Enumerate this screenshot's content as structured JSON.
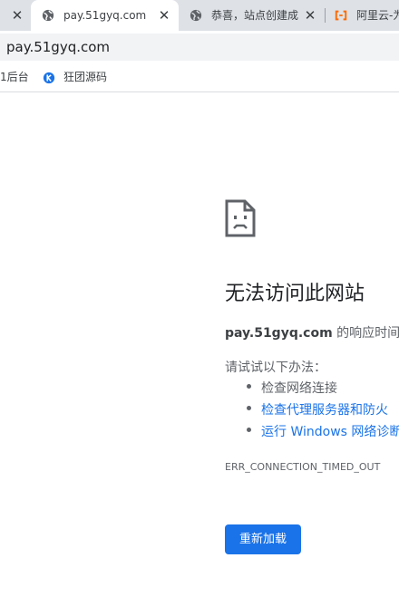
{
  "tabs": [
    {
      "title": "",
      "icon": "close-icon"
    },
    {
      "title": "pay.51gyq.com",
      "icon": "globe-icon",
      "active": true
    },
    {
      "title": "恭喜，站点创建成",
      "icon": "globe-icon"
    },
    {
      "title": "阿里云-为",
      "icon": "aliyun-icon"
    }
  ],
  "address": {
    "url": "pay.51gyq.com"
  },
  "bookmarks": [
    {
      "label": "1后台"
    },
    {
      "label": "狂团源码",
      "icon": "k-logo-icon"
    }
  ],
  "error": {
    "title": "无法访问此网站",
    "host": "pay.51gyq.com",
    "message_rest": " 的响应时间过",
    "try_title": "请试试以下办法：",
    "suggestions": [
      "检查网络连接",
      "检查代理服务器和防火",
      "运行 Windows 网络诊断"
    ],
    "code": "ERR_CONNECTION_TIMED_OUT",
    "reload_label": "重新加载"
  },
  "colors": {
    "accent": "#1a73e8",
    "tabstrip": "#dee1e6",
    "text": "#202124",
    "secondary_text": "#5f6368"
  }
}
